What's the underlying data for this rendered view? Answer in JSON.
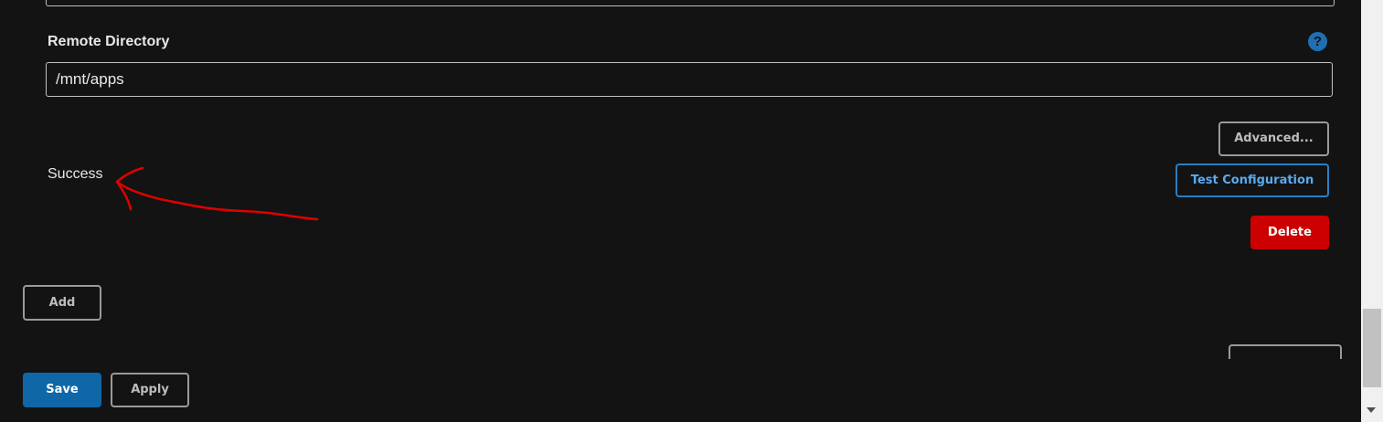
{
  "form": {
    "remote_directory_label": "Remote Directory",
    "remote_directory_value": "/mnt/apps",
    "help_icon_glyph": "?"
  },
  "actions": {
    "advanced_label": "Advanced...",
    "test_configuration_label": "Test Configuration",
    "delete_label": "Delete",
    "add_label": "Add",
    "save_label": "Save",
    "apply_label": "Apply"
  },
  "status": {
    "message": "Success"
  },
  "colors": {
    "background": "#131313",
    "primary": "#0f67a8",
    "danger": "#cc0000",
    "link_blue": "#2a7fc4",
    "annotation_red": "#e00000"
  },
  "icons": {
    "help": "question-circle-icon",
    "scroll_down": "chevron-down-icon"
  }
}
